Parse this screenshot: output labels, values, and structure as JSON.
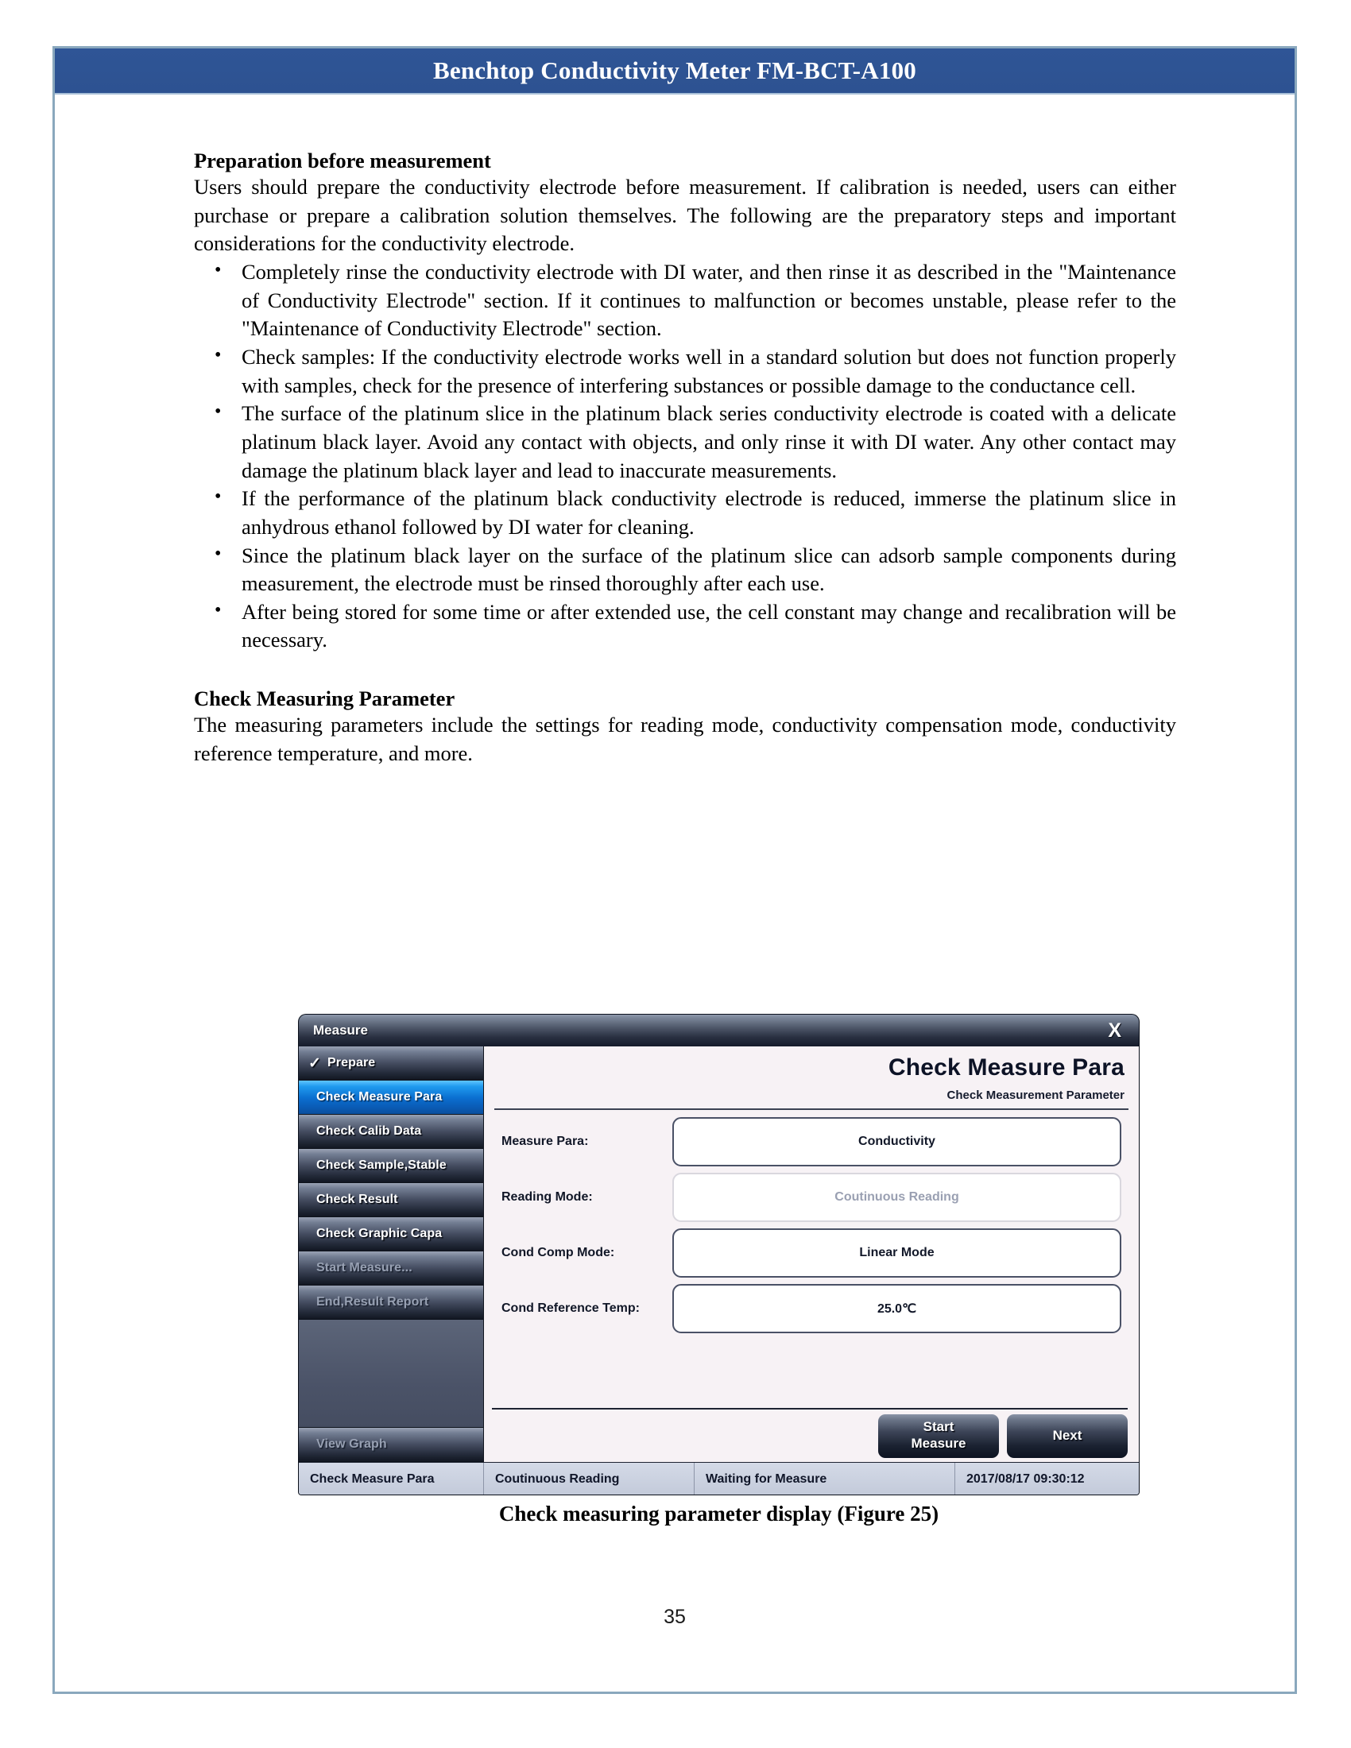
{
  "header": {
    "title": "Benchtop Conductivity Meter FM-BCT-A100",
    "banner_color": "#2e5395",
    "frame_color": "#8aa8bd"
  },
  "document": {
    "section1": {
      "heading": "Preparation before measurement",
      "intro": "Users should prepare the conductivity electrode before measurement. If calibration is needed, users can either purchase or prepare a calibration solution themselves. The following are the preparatory steps and important considerations for the conductivity electrode.",
      "bullets": [
        "Completely rinse the conductivity electrode with DI water, and then rinse it as described in the \"Maintenance of Conductivity Electrode\" section. If it continues to malfunction or becomes unstable, please refer to the \"Maintenance of Conductivity Electrode\" section.",
        "Check samples: If the conductivity electrode works well in a standard solution but does not function properly with samples, check for the presence of interfering substances or possible damage to the conductance cell.",
        "The surface of the platinum slice in the platinum black series conductivity electrode is coated with a delicate platinum black layer. Avoid any contact with objects, and only rinse it with DI water. Any other contact may damage the platinum black layer and lead to inaccurate measurements.",
        "If the performance of the platinum black conductivity electrode is reduced, immerse the platinum slice in anhydrous ethanol followed by DI water for cleaning.",
        "Since the platinum black layer on the surface of the platinum slice can adsorb sample components during measurement, the electrode must be rinsed thoroughly after each use.",
        "After being stored for some time or after extended use, the cell constant may change and recalibration will be necessary."
      ]
    },
    "section2": {
      "heading": "Check Measuring Parameter",
      "intro": "The measuring parameters include the settings for reading mode, conductivity compensation mode, conductivity reference temperature, and more."
    },
    "figure_caption": "Check measuring parameter display (Figure 25)",
    "page_number": "35"
  },
  "device": {
    "titlebar": {
      "title": "Measure",
      "close_label": "X"
    },
    "sidebar": {
      "items": [
        {
          "label": "Prepare",
          "state": "checked",
          "check": "✓"
        },
        {
          "label": "Check Measure Para",
          "state": "active"
        },
        {
          "label": "Check Calib Data",
          "state": "normal"
        },
        {
          "label": "Check Sample,Stable",
          "state": "normal"
        },
        {
          "label": "Check Result",
          "state": "normal"
        },
        {
          "label": "Check Graphic Capa",
          "state": "normal"
        },
        {
          "label": "Start Measure...",
          "state": "disabled"
        },
        {
          "label": "End,Result Report",
          "state": "disabled"
        }
      ],
      "bottom_item": {
        "label": "View Graph",
        "state": "disabled"
      }
    },
    "content": {
      "title": "Check Measure Para",
      "subtitle": "Check Measurement Parameter",
      "fields": [
        {
          "label": "Measure Para:",
          "value": "Conductivity",
          "disabled": false
        },
        {
          "label": "Reading Mode:",
          "value": "Coutinuous Reading",
          "disabled": true
        },
        {
          "label": "Cond Comp Mode:",
          "value": "Linear Mode",
          "disabled": false
        },
        {
          "label": "Cond Reference Temp:",
          "value": "25.0℃",
          "disabled": false
        }
      ]
    },
    "actions": {
      "start_measure_line1": "Start",
      "start_measure_line2": "Measure",
      "next": "Next"
    },
    "statusbar": {
      "cell1": "Check Measure Para",
      "cell2": "Coutinuous Reading",
      "cell3": "Waiting for Measure",
      "cell4": "2017/08/17 09:30:12"
    },
    "colors": {
      "accent": "#0b6fd0",
      "panel_bg": "#f7f2f5",
      "chrome_dark": "#0d1322",
      "status_bg": "#ccd2e0"
    }
  }
}
